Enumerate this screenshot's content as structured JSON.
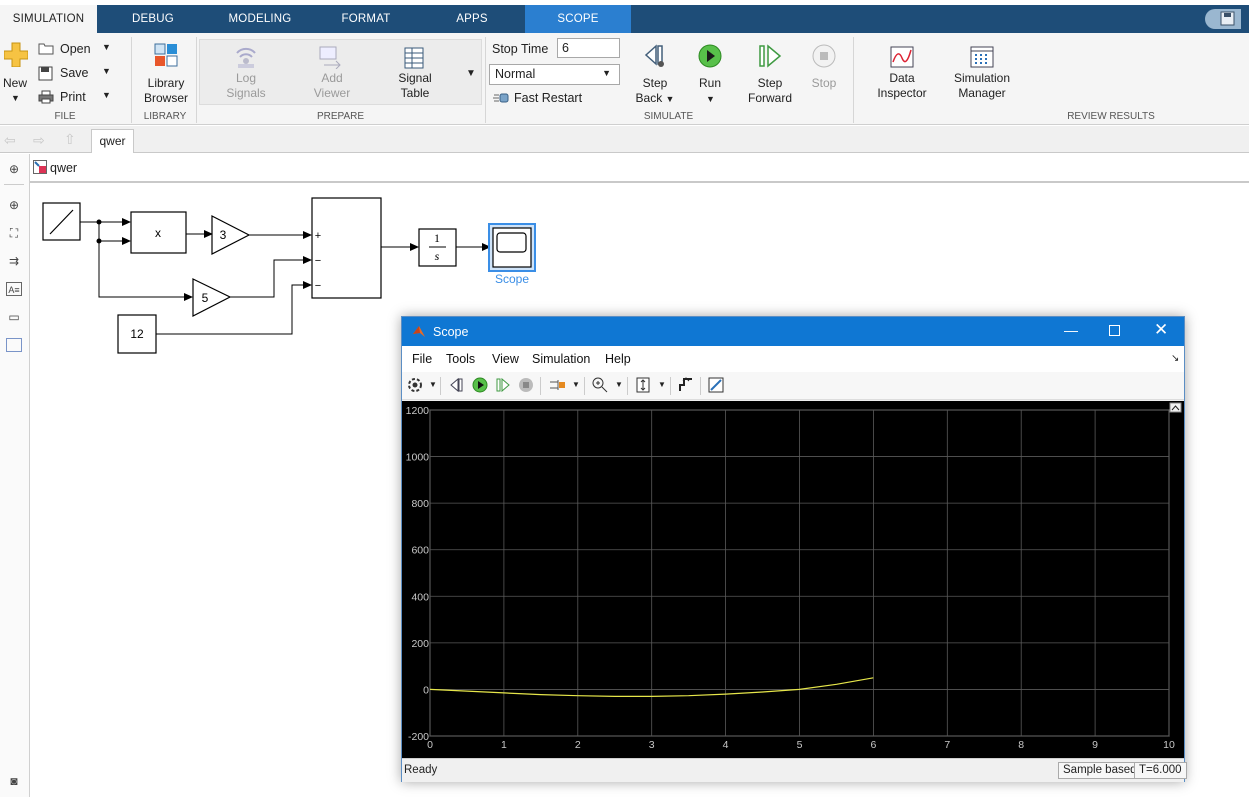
{
  "tabs": [
    "SIMULATION",
    "DEBUG",
    "MODELING",
    "FORMAT",
    "APPS",
    "SCOPE"
  ],
  "file_group": {
    "new": "New",
    "open": "Open",
    "save": "Save",
    "print": "Print",
    "label": "FILE"
  },
  "library_group": {
    "library_browser_line1": "Library",
    "library_browser_line2": "Browser",
    "label": "LIBRARY"
  },
  "prepare_group": {
    "log_signals_line1": "Log",
    "log_signals_line2": "Signals",
    "add_viewer_line1": "Add",
    "add_viewer_line2": "Viewer",
    "signal_table_line1": "Signal",
    "signal_table_line2": "Table",
    "label": "PREPARE"
  },
  "simulate_group": {
    "stop_time_label": "Stop Time",
    "stop_time_value": "6",
    "mode_value": "Normal",
    "fast_restart": "Fast Restart",
    "step_back_line1": "Step",
    "step_back_line2": "Back",
    "run": "Run",
    "step_forward_line1": "Step",
    "step_forward_line2": "Forward",
    "stop": "Stop",
    "label": "SIMULATE"
  },
  "review_group": {
    "data_inspector_line1": "Data",
    "data_inspector_line2": "Inspector",
    "sim_manager_line1": "Simulation",
    "sim_manager_line2": "Manager",
    "label": "REVIEW RESULTS"
  },
  "model_tab": "qwer",
  "breadcrumb": "qwer",
  "diagram": {
    "product_label": "x",
    "gain1_label": "3",
    "gain2_label": "5",
    "constant_label": "12",
    "sum_signs": [
      "+",
      "−",
      "−"
    ],
    "integrator_num": "1",
    "integrator_den": "s",
    "scope_label": "Scope"
  },
  "scope_window": {
    "title": "Scope",
    "menu": [
      "File",
      "Tools",
      "View",
      "Simulation",
      "Help"
    ],
    "status_left": "Ready",
    "status_mode": "Sample based",
    "status_time": "T=6.000"
  },
  "colors": {
    "ribbon_tabs": "#1e4d78",
    "scope_tab": "#2b7fd0",
    "scope_titlebar": "#0f77d3",
    "trace": "#e6e64a",
    "selection": "#3a8ee6"
  },
  "chart_data": {
    "type": "line",
    "x_ticks": [
      "0",
      "1",
      "2",
      "3",
      "4",
      "5",
      "6",
      "7",
      "8",
      "9",
      "10"
    ],
    "y_ticks": [
      "-200",
      "0",
      "200",
      "400",
      "600",
      "800",
      "1000",
      "1200"
    ],
    "xlim": [
      0,
      10
    ],
    "ylim": [
      -200,
      1200
    ],
    "grid": true,
    "series": [
      {
        "x": [
          0,
          0.5,
          1,
          1.5,
          2,
          2.5,
          3,
          3.5,
          4,
          4.5,
          5,
          5.5,
          6
        ],
        "y": [
          0,
          -7,
          -15,
          -22,
          -27,
          -30,
          -30,
          -27,
          -20,
          -11,
          0,
          22,
          50
        ]
      }
    ]
  }
}
